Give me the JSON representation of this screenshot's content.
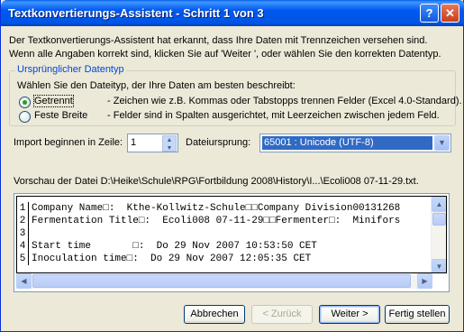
{
  "window": {
    "title": "Textkonvertierungs-Assistent - Schritt 1 von 3",
    "help_label": "?",
    "close_label": "✕"
  },
  "intro": {
    "line1": "Der Textkonvertierungs-Assistent hat erkannt, dass Ihre Daten mit Trennzeichen versehen sind.",
    "line2": "Wenn alle Angaben korrekt sind, klicken Sie auf 'Weiter ', oder wählen Sie den korrekten Datentyp."
  },
  "datatype_group": {
    "legend": "Ursprünglicher Datentyp",
    "prompt": "Wählen Sie den Dateityp, der Ihre Daten am besten beschreibt:",
    "options": [
      {
        "label": "Getrennt",
        "description": "- Zeichen wie z.B. Kommas oder Tabstopps trennen Felder (Excel 4.0-Standard).",
        "selected": true
      },
      {
        "label": "Feste Breite",
        "description": "- Felder sind in Spalten ausgerichtet, mit Leerzeichen zwischen jedem Feld.",
        "selected": false
      }
    ]
  },
  "import": {
    "label": "Import beginnen in Zeile:",
    "value": "1",
    "origin_label": "Dateiursprung:",
    "origin_value": "65001 : Unicode (UTF-8)"
  },
  "preview": {
    "label": "Vorschau der Datei D:\\Heike\\Schule\\RPG\\Fortbildung 2008\\History\\I...\\Ecoli008 07-11-29.txt.",
    "rows": [
      {
        "num": "1",
        "text": "Company Name□:  Kthe-Kollwitz-Schule□□Company Division00131268"
      },
      {
        "num": "2",
        "text": "Fermentation Title□:  Ecoli008 07-11-29□□Fermenter□:  Minifors"
      },
      {
        "num": "3",
        "text": ""
      },
      {
        "num": "4",
        "text": "Start time       □:  Do 29 Nov 2007 10:53:50 CET"
      },
      {
        "num": "5",
        "text": "Inoculation time□:  Do 29 Nov 2007 12:05:35 CET"
      }
    ]
  },
  "buttons": {
    "cancel": "Abbrechen",
    "back": "< Zurück",
    "next": "Weiter >",
    "finish": "Fertig stellen"
  }
}
